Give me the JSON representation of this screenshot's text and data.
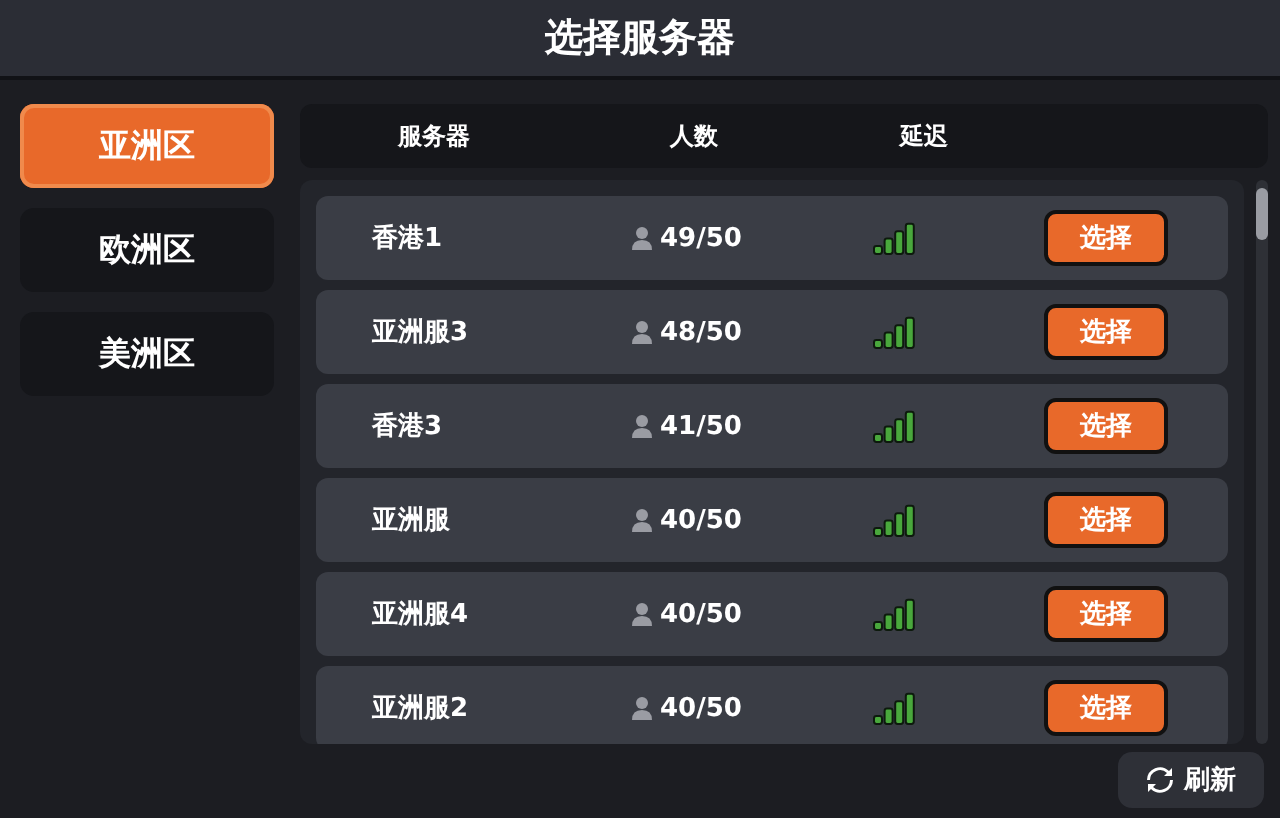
{
  "window": {
    "title": "选择服务器"
  },
  "regions": [
    {
      "label": "亚洲区",
      "selected": true
    },
    {
      "label": "欧洲区",
      "selected": false
    },
    {
      "label": "美洲区",
      "selected": false
    }
  ],
  "table": {
    "columns": [
      "服务器",
      "人数",
      "延迟"
    ],
    "rows": [
      {
        "server": "香港1",
        "players": "49/50",
        "action": "选择"
      },
      {
        "server": "亚洲服3",
        "players": "48/50",
        "action": "选择"
      },
      {
        "server": "香港3",
        "players": "41/50",
        "action": "选择"
      },
      {
        "server": "亚洲服",
        "players": "40/50",
        "action": "选择"
      },
      {
        "server": "亚洲服4",
        "players": "40/50",
        "action": "选择"
      },
      {
        "server": "亚洲服2",
        "players": "40/50",
        "action": "选择"
      }
    ]
  },
  "refresh_button": {
    "label": "刷新"
  }
}
